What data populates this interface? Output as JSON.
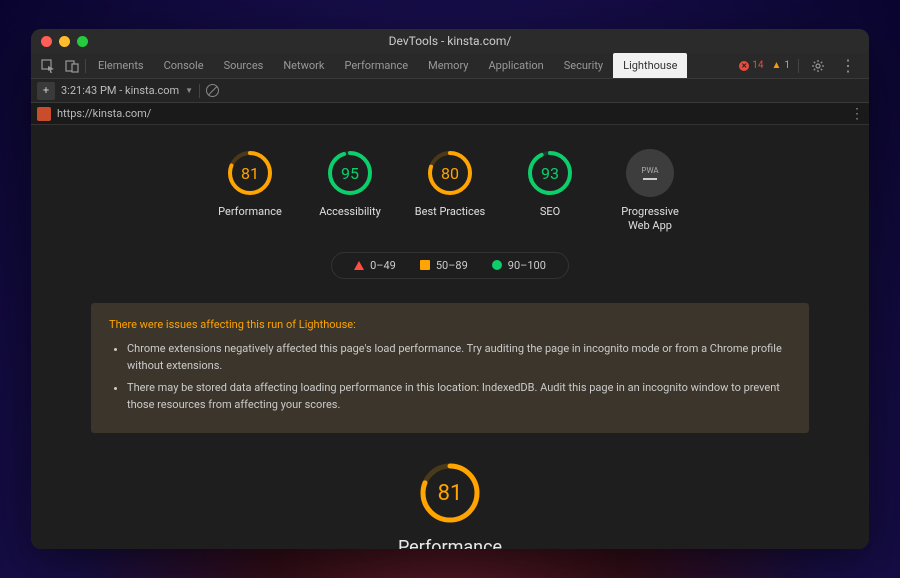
{
  "window": {
    "title": "DevTools - kinsta.com/"
  },
  "toolbar": {
    "tabs": [
      "Elements",
      "Console",
      "Sources",
      "Network",
      "Performance",
      "Memory",
      "Application",
      "Security",
      "Lighthouse"
    ],
    "active_tab_index": 8,
    "errors": "14",
    "warnings": "1"
  },
  "subbar": {
    "timestamp": "3:21:43 PM - kinsta.com"
  },
  "urlbar": {
    "url": "https://kinsta.com/"
  },
  "gauges": [
    {
      "label": "Performance",
      "value": "81",
      "color": "#ffa400",
      "pct": 81
    },
    {
      "label": "Accessibility",
      "value": "95",
      "color": "#0cce6b",
      "pct": 95
    },
    {
      "label": "Best Practices",
      "value": "80",
      "color": "#ffa400",
      "pct": 80
    },
    {
      "label": "SEO",
      "value": "93",
      "color": "#0cce6b",
      "pct": 93
    }
  ],
  "pwa": {
    "label": "Progressive Web App",
    "badge": "PWA"
  },
  "legend": [
    {
      "range": "0–49",
      "shape": "tri"
    },
    {
      "range": "50–89",
      "shape": "sq"
    },
    {
      "range": "90–100",
      "shape": "circ"
    }
  ],
  "issues": {
    "title": "There were issues affecting this run of Lighthouse:",
    "items": [
      "Chrome extensions negatively affected this page's load performance. Try auditing the page in incognito mode or from a Chrome profile without extensions.",
      "There may be stored data affecting loading performance in this location: IndexedDB. Audit this page in an incognito window to prevent those resources from affecting your scores."
    ]
  },
  "big_gauge": {
    "value": "81",
    "label": "Performance",
    "pct": 81,
    "color": "#ffa400"
  }
}
